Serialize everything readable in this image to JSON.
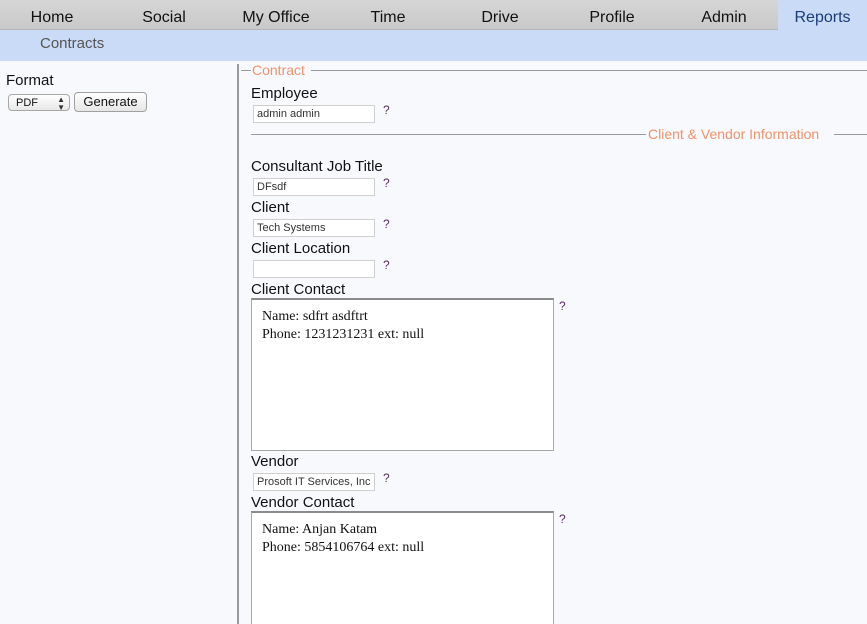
{
  "nav": {
    "items": [
      {
        "label": "Home"
      },
      {
        "label": "Social"
      },
      {
        "label": "My Office"
      },
      {
        "label": "Time"
      },
      {
        "label": "Drive"
      },
      {
        "label": "Profile"
      },
      {
        "label": "Admin"
      },
      {
        "label": "Reports"
      }
    ],
    "active": "Reports"
  },
  "subnav": {
    "items": [
      {
        "label": "Contracts"
      }
    ]
  },
  "sidebar": {
    "format_label": "Format",
    "format_value": "PDF",
    "generate_label": "Generate"
  },
  "form": {
    "contract_legend": "Contract",
    "employee_label": "Employee",
    "employee_value": "admin admin",
    "client_vendor_legend": "Client & Vendor Information",
    "job_title_label": "Consultant Job Title",
    "job_title_value": "DFsdf",
    "client_label": "Client",
    "client_value": "Tech Systems",
    "client_location_label": "Client Location",
    "client_location_value": "",
    "client_contact_label": "Client Contact",
    "client_contact_lines": [
      "Name: sdfrt asdftrt",
      "Phone: 1231231231 ext: null"
    ],
    "vendor_label": "Vendor",
    "vendor_value": "Prosoft IT Services, Inc",
    "vendor_contact_label": "Vendor Contact",
    "vendor_contact_lines": [
      "Name: Anjan Katam",
      "Phone: 5854106764 ext: null"
    ],
    "help_glyph": "?"
  },
  "colors": {
    "legend": "#f0926b",
    "subnav_bg": "#c9dbf6",
    "nav_bg": "#cccccc",
    "help": "#5a2a6a"
  }
}
